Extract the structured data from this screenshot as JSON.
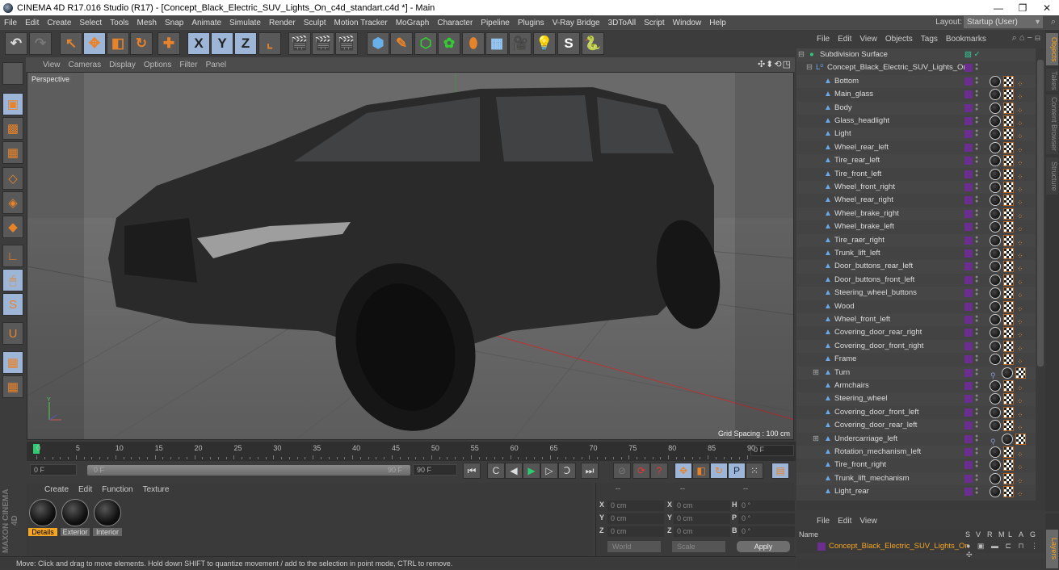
{
  "window": {
    "title": "CINEMA 4D R17.016 Studio (R17) - [Concept_Black_Electric_SUV_Lights_On_c4d_standart.c4d *] - Main",
    "controls": {
      "minimize": "—",
      "restore": "❐",
      "close": "✕"
    }
  },
  "menubar": {
    "items": [
      "File",
      "Edit",
      "Create",
      "Select",
      "Tools",
      "Mesh",
      "Snap",
      "Animate",
      "Simulate",
      "Render",
      "Sculpt",
      "Motion Tracker",
      "MoGraph",
      "Character",
      "Pipeline",
      "Plugins",
      "V-Ray Bridge",
      "3DToAll",
      "Script",
      "Window",
      "Help"
    ],
    "layout_label": "Layout:",
    "layout_value": "Startup (User)"
  },
  "toolbar": {
    "buttons": [
      {
        "name": "undo-icon",
        "glyph": "↶"
      },
      {
        "name": "redo-icon",
        "glyph": "↷"
      },
      {
        "name": "live-selection-icon",
        "glyph": "↖"
      },
      {
        "name": "move-icon",
        "glyph": "✥"
      },
      {
        "name": "scale-icon",
        "glyph": "◧"
      },
      {
        "name": "rotate-icon",
        "glyph": "↻"
      },
      {
        "name": "last-tool-icon",
        "glyph": "✚"
      },
      {
        "name": "x-axis-icon",
        "glyph": "X"
      },
      {
        "name": "y-axis-icon",
        "glyph": "Y"
      },
      {
        "name": "z-axis-icon",
        "glyph": "Z"
      },
      {
        "name": "coordinate-system-icon",
        "glyph": "⌞"
      },
      {
        "name": "render-view-icon",
        "glyph": "🎬"
      },
      {
        "name": "render-picture-viewer-icon",
        "glyph": "🎬"
      },
      {
        "name": "render-settings-icon",
        "glyph": "🎬"
      },
      {
        "name": "cube-icon",
        "glyph": "⬢"
      },
      {
        "name": "pen-spline-icon",
        "glyph": "✎"
      },
      {
        "name": "subdivision-icon",
        "glyph": "⬡"
      },
      {
        "name": "cloner-icon",
        "glyph": "✿"
      },
      {
        "name": "deformer-icon",
        "glyph": "⬮"
      },
      {
        "name": "floor-icon",
        "glyph": "▦"
      },
      {
        "name": "camera-icon",
        "glyph": "🎥"
      },
      {
        "name": "light-icon",
        "glyph": "💡"
      },
      {
        "name": "3dtoall-icon",
        "glyph": "S"
      },
      {
        "name": "python-icon",
        "glyph": "🐍"
      }
    ]
  },
  "left_tools": [
    {
      "name": "viewport-solo-icon"
    },
    {
      "name": "model-mode-icon",
      "glyph": "▣"
    },
    {
      "name": "texture-mode-icon",
      "glyph": "▩"
    },
    {
      "name": "workplane-mode-icon",
      "glyph": "▦"
    },
    {
      "name": "points-mode-icon",
      "glyph": "◇"
    },
    {
      "name": "edges-mode-icon",
      "glyph": "◈"
    },
    {
      "name": "polygons-mode-icon",
      "glyph": "◆"
    },
    {
      "name": "axis-mode-icon",
      "glyph": "∟"
    },
    {
      "name": "tweak-mode-icon",
      "glyph": "🖱"
    },
    {
      "name": "snap-icon",
      "glyph": "S"
    },
    {
      "name": "magnet-icon",
      "glyph": "U"
    },
    {
      "name": "workplane-lock-icon",
      "glyph": "▦"
    },
    {
      "name": "workplane-align-icon",
      "glyph": "▦"
    }
  ],
  "viewport": {
    "menu": [
      "View",
      "Cameras",
      "Display",
      "Options",
      "Filter",
      "Panel"
    ],
    "camera_label": "Perspective",
    "grid_spacing": "Grid Spacing : 100 cm",
    "nav_icons": "✣⬍⟲◳"
  },
  "timeline": {
    "ticks": [
      "0",
      "5",
      "10",
      "15",
      "20",
      "25",
      "30",
      "35",
      "40",
      "45",
      "50",
      "55",
      "60",
      "65",
      "70",
      "75",
      "80",
      "85",
      "90"
    ],
    "current_frame": "0 F",
    "start_frame": "0 F",
    "range_start": "0 F",
    "range_end": "90 F",
    "end_frame": "90 F"
  },
  "transport": {
    "buttons": [
      {
        "name": "go-to-start-icon",
        "glyph": "⏮"
      },
      {
        "name": "previous-key-icon",
        "glyph": "C"
      },
      {
        "name": "previous-frame-icon",
        "glyph": "◀"
      },
      {
        "name": "play-icon",
        "glyph": "▶"
      },
      {
        "name": "next-frame-icon",
        "glyph": "▷"
      },
      {
        "name": "next-key-icon",
        "glyph": "Ↄ"
      },
      {
        "name": "go-to-end-icon",
        "glyph": "⏭"
      },
      {
        "name": "record-disabled-icon",
        "glyph": "⊘"
      },
      {
        "name": "autokey-icon",
        "glyph": "⟳"
      },
      {
        "name": "keyframe-selection-icon",
        "glyph": "?"
      },
      {
        "name": "key-position-icon",
        "glyph": "✥"
      },
      {
        "name": "key-scale-icon",
        "glyph": "◧"
      },
      {
        "name": "key-rotation-icon",
        "glyph": "↻"
      },
      {
        "name": "key-parameter-icon",
        "glyph": "P"
      },
      {
        "name": "key-pla-icon",
        "glyph": "⁙"
      },
      {
        "name": "timeline-icon",
        "glyph": "▤"
      }
    ]
  },
  "materials": {
    "menu": [
      "Create",
      "Edit",
      "Function",
      "Texture"
    ],
    "items": [
      {
        "label": "Details",
        "selected": true
      },
      {
        "label": "Exterior",
        "selected": false
      },
      {
        "label": "Interior",
        "selected": false
      }
    ],
    "brand": "MAXON CINEMA 4D"
  },
  "coordinates": {
    "headers": [
      "--",
      "--",
      "--"
    ],
    "position": {
      "x": "0 cm",
      "y": "0 cm",
      "z": "0 cm"
    },
    "size": {
      "x": "0 cm",
      "y": "0 cm",
      "z": "0 cm"
    },
    "rotation": {
      "h": "0 °",
      "p": "0 °",
      "b": "0 °"
    },
    "labels": {
      "x": "X",
      "y": "Y",
      "z": "Z",
      "h": "H",
      "p": "P",
      "b": "B"
    },
    "space": "World",
    "mode": "Scale",
    "apply": "Apply"
  },
  "status": "Move: Click and drag to move elements. Hold down SHIFT to quantize movement / add to the selection in point mode, CTRL to remove.",
  "object_manager": {
    "menu": [
      "File",
      "Edit",
      "View",
      "Objects",
      "Tags",
      "Bookmarks"
    ],
    "root": "Subdivision Surface",
    "group": "Concept_Black_Electric_SUV_Lights_On",
    "objects": [
      {
        "name": "Bottom"
      },
      {
        "name": "Main_glass"
      },
      {
        "name": "Body"
      },
      {
        "name": "Glass_headlight"
      },
      {
        "name": "Light"
      },
      {
        "name": "Wheel_rear_left"
      },
      {
        "name": "Tire_rear_left"
      },
      {
        "name": "Tire_front_left"
      },
      {
        "name": "Wheel_front_right"
      },
      {
        "name": "Wheel_rear_right"
      },
      {
        "name": "Wheel_brake_right"
      },
      {
        "name": "Wheel_brake_left"
      },
      {
        "name": "Tire_raer_right"
      },
      {
        "name": "Trunk_lift_left"
      },
      {
        "name": "Door_buttons_rear_left"
      },
      {
        "name": "Door_buttons_front_left"
      },
      {
        "name": "Steering_wheel_buttons"
      },
      {
        "name": "Wood"
      },
      {
        "name": "Wheel_front_left"
      },
      {
        "name": "Covering_door_rear_right"
      },
      {
        "name": "Covering_door_front_right"
      },
      {
        "name": "Frame"
      },
      {
        "name": "Turn",
        "expandable": true
      },
      {
        "name": "Armchairs"
      },
      {
        "name": "Steering_wheel"
      },
      {
        "name": "Covering_door_front_left"
      },
      {
        "name": "Covering_door_rear_left"
      },
      {
        "name": "Undercarriage_left",
        "expandable": true
      },
      {
        "name": "Rotation_mechanism_left"
      },
      {
        "name": "Tire_front_right"
      },
      {
        "name": "Trunk_lift_mechanism"
      },
      {
        "name": "Light_rear"
      }
    ]
  },
  "side_tabs": [
    "Objects",
    "Takes",
    "Content Browser",
    "Structure"
  ],
  "layer_manager": {
    "menu": [
      "File",
      "Edit",
      "View"
    ],
    "columns": [
      "Name",
      "S",
      "V",
      "R",
      "M",
      "L",
      "A",
      "G"
    ],
    "layer": "Concept_Black_Electric_SUV_Lights_On",
    "tab": "Layers"
  },
  "colors": {
    "accent": "#f5a623",
    "layer": "#6a2f8e",
    "selected_tool": "#9db5d6",
    "playhead": "#2ecc71"
  }
}
